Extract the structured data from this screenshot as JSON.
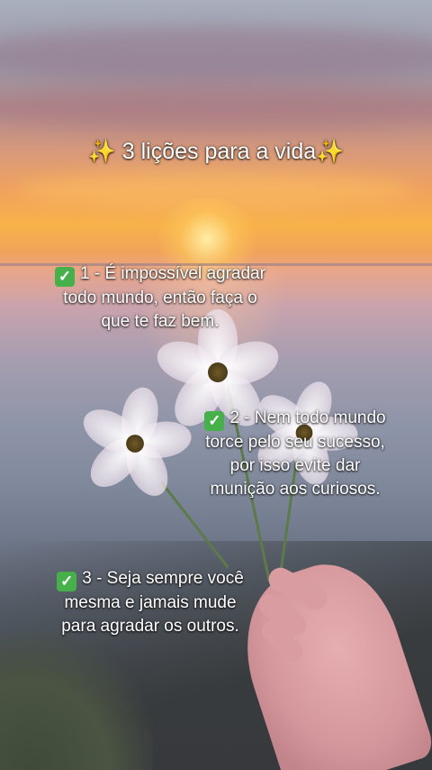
{
  "title": {
    "sparkle_left": "✨",
    "text": "3 lições para a vida",
    "sparkle_right": "✨"
  },
  "lessons": [
    {
      "icon": "check-mark-button-icon",
      "check": "✓",
      "lines": [
        "1 - É impossível agradar",
        "todo mundo, então faça o",
        "que te faz bem."
      ]
    },
    {
      "icon": "check-mark-button-icon",
      "check": "✓",
      "lines": [
        "2 - Nem todo mundo",
        "torce pelo seu sucesso,",
        "por isso evite dar",
        "munição aos curiosos."
      ]
    },
    {
      "icon": "check-mark-button-icon",
      "check": "✓",
      "lines": [
        "3 - Seja sempre você",
        "mesma e jamais mude",
        "para agradar os outros."
      ]
    }
  ],
  "colors": {
    "check_green": "#46b04a",
    "sparkle_yellow": "#ffd84a",
    "text": "#ffffff"
  }
}
